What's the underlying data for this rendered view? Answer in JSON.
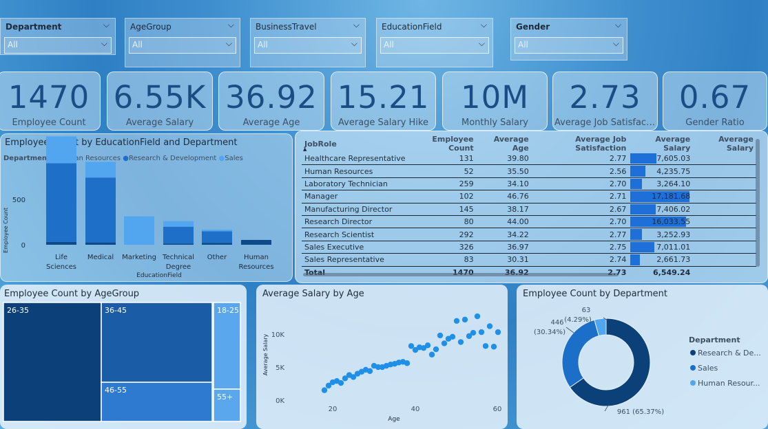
{
  "slicers": [
    {
      "title": "Department",
      "value": "All"
    },
    {
      "title": "AgeGroup",
      "value": "All"
    },
    {
      "title": "BusinessTravel",
      "value": "All"
    },
    {
      "title": "EducationField",
      "value": "All"
    },
    {
      "title": "Gender",
      "value": "All"
    }
  ],
  "kpis": [
    {
      "value": "1470",
      "label": "Employee Count"
    },
    {
      "value": "6.55K",
      "label": "Average Salary"
    },
    {
      "value": "36.92",
      "label": "Average Age"
    },
    {
      "value": "15.21",
      "label": "Average Salary Hike"
    },
    {
      "value": "10M",
      "label": "Monthly Salary"
    },
    {
      "value": "2.73",
      "label": "Average Job Satisfacti..."
    },
    {
      "value": "0.67",
      "label": "Gender Ratio"
    }
  ],
  "edu_chart": {
    "title": "Employee Count by EducationField and Department",
    "legend_title": "Department",
    "legend": [
      "Human Resources",
      "Research & Development",
      "Sales"
    ],
    "xlabel": "EducationField",
    "ylabel": "Employee Count",
    "yticks": [
      "500",
      "0"
    ]
  },
  "job_table": {
    "headers": [
      "JobRole",
      "Employee Count",
      "Average Age",
      "Average Job Satisfaction",
      "Average Salary",
      "Average Salary"
    ],
    "rows": [
      {
        "role": "Healthcare Representative",
        "count": "131",
        "age": "39.80",
        "sat": "2.77",
        "salary": "7,605.03",
        "sal_num": 7605.03
      },
      {
        "role": "Human Resources",
        "count": "52",
        "age": "35.50",
        "sat": "2.56",
        "salary": "4,235.75",
        "sal_num": 4235.75
      },
      {
        "role": "Laboratory Technician",
        "count": "259",
        "age": "34.10",
        "sat": "2.70",
        "salary": "3,264.10",
        "sal_num": 3264.1
      },
      {
        "role": "Manager",
        "count": "102",
        "age": "46.76",
        "sat": "2.71",
        "salary": "17,181.68",
        "sal_num": 17181.68
      },
      {
        "role": "Manufacturing Director",
        "count": "145",
        "age": "38.17",
        "sat": "2.67",
        "salary": "7,406.02",
        "sal_num": 7406.02
      },
      {
        "role": "Research Director",
        "count": "80",
        "age": "44.00",
        "sat": "2.70",
        "salary": "16,033.55",
        "sal_num": 16033.55
      },
      {
        "role": "Research Scientist",
        "count": "292",
        "age": "34.22",
        "sat": "2.77",
        "salary": "3,252.93",
        "sal_num": 3252.93
      },
      {
        "role": "Sales Executive",
        "count": "326",
        "age": "36.97",
        "sat": "2.75",
        "salary": "7,011.01",
        "sal_num": 7011.01
      },
      {
        "role": "Sales Representative",
        "count": "83",
        "age": "30.31",
        "sat": "2.74",
        "salary": "2,661.73",
        "sal_num": 2661.73
      }
    ],
    "total": {
      "role": "Total",
      "count": "1470",
      "age": "36.92",
      "sat": "2.73",
      "salary": "6,549.24"
    }
  },
  "age_chart": {
    "title": "Employee Count by AgeGroup",
    "groups": [
      "26-35",
      "36-45",
      "46-55",
      "18-25",
      "55+"
    ],
    "colors": [
      "#0b4178",
      "#1b5ca7",
      "#2e7ad0",
      "#5aa7ee",
      "#5aa7ee"
    ]
  },
  "salary_age": {
    "title": "Average Salary by Age",
    "xlabel": "Age",
    "ylabel": "Average Salary",
    "yticks": [
      "10K",
      "5K",
      "0K"
    ],
    "xticks": [
      "20",
      "40",
      "60"
    ]
  },
  "dept_chart": {
    "title": "Employee Count by Department",
    "legend_title": "Department",
    "legend": [
      "Research & De...",
      "Sales",
      "Human Resour..."
    ],
    "labels": {
      "hr_value": "63",
      "hr_pct": "(4.29%)",
      "sales_value": "446",
      "sales_pct": "(30.34%)",
      "rd_label": "961 (65.37%)"
    }
  },
  "chart_data": [
    {
      "type": "bar",
      "title": "Employee Count by EducationField and Department",
      "categories": [
        "Life Sciences",
        "Medical",
        "Marketing",
        "Technical Degree",
        "Other",
        "Human Resources"
      ],
      "series": [
        {
          "name": "Human Resources",
          "values": [
            16,
            13,
            0,
            7,
            11,
            27
          ]
        },
        {
          "name": "Research & Development",
          "values": [
            440,
            363,
            0,
            94,
            64,
            0
          ]
        },
        {
          "name": "Sales",
          "values": [
            150,
            88,
            159,
            31,
            9,
            0
          ]
        }
      ],
      "colors": [
        "#0e4a8a",
        "#1d6fc8",
        "#52a6f0"
      ],
      "xlabel": "EducationField",
      "ylabel": "Employee Count",
      "ylim": [
        0,
        700
      ]
    },
    {
      "type": "scatter",
      "title": "Average Salary by Age",
      "xlabel": "Age",
      "ylabel": "Average Salary",
      "xlim": [
        18,
        60
      ],
      "ylim": [
        0,
        15000
      ],
      "x": [
        18,
        19,
        20,
        21,
        22,
        23,
        24,
        25,
        26,
        27,
        28,
        29,
        30,
        31,
        32,
        33,
        34,
        35,
        36,
        37,
        38,
        39,
        40,
        41,
        42,
        43,
        44,
        45,
        46,
        47,
        48,
        49,
        50,
        51,
        52,
        53,
        54,
        55,
        56,
        57,
        58,
        59,
        60
      ],
      "y": [
        1500,
        2200,
        2700,
        2900,
        2600,
        3300,
        3800,
        3500,
        4000,
        4300,
        4600,
        4400,
        5200,
        5000,
        5000,
        5200,
        5400,
        5500,
        5700,
        5800,
        5600,
        8200,
        7600,
        8000,
        7900,
        8300,
        6900,
        7700,
        9800,
        8600,
        9300,
        9600,
        12000,
        8800,
        12200,
        9700,
        10200,
        12700,
        10300,
        8200,
        11200,
        8100,
        10300
      ]
    },
    {
      "type": "pie",
      "title": "Employee Count by Department",
      "categories": [
        "Research & Development",
        "Sales",
        "Human Resources"
      ],
      "values": [
        961,
        446,
        63
      ],
      "colors": [
        "#0b4178",
        "#1b6fc8",
        "#52a6f0"
      ]
    }
  ]
}
